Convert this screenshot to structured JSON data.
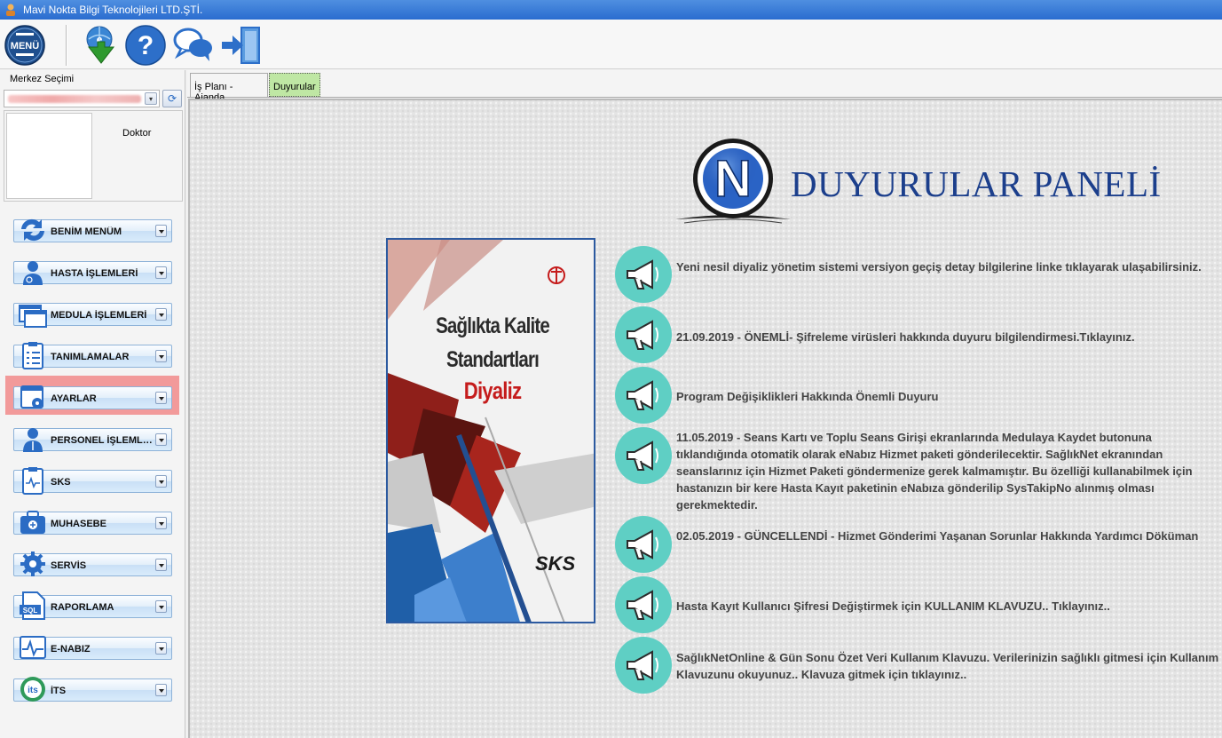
{
  "window": {
    "title": "Mavi Nokta Bilgi Teknolojileri LTD.ŞTİ."
  },
  "toolbar": {
    "menu_label": "MENÜ",
    "buttons": [
      "internet-download-icon",
      "help-icon",
      "chat-icon",
      "logout-icon"
    ]
  },
  "sidebar": {
    "merkez_label": "Merkez Seçimi",
    "role": "Doktor",
    "items": [
      {
        "label": "BENİM MENÜM",
        "icon": "arrows-icon"
      },
      {
        "label": "HASTA İŞLEMLERİ",
        "icon": "patient-icon"
      },
      {
        "label": "MEDULA İŞLEMLERİ",
        "icon": "windows-icon"
      },
      {
        "label": "TANIMLAMALAR",
        "icon": "clipboard-icon"
      },
      {
        "label": "AYARLAR",
        "icon": "settings-calendar-icon"
      },
      {
        "label": "PERSONEL İŞLEMLERİ",
        "icon": "staff-icon"
      },
      {
        "label": "SKS",
        "icon": "sks-clipboard-icon"
      },
      {
        "label": "MUHASEBE",
        "icon": "accounting-icon"
      },
      {
        "label": "SERVİS",
        "icon": "service-gear-icon"
      },
      {
        "label": "RAPORLAMA",
        "icon": "sql-report-icon"
      },
      {
        "label": "E-NABIZ",
        "icon": "pulse-icon"
      },
      {
        "label": "İTS",
        "icon": "its-icon"
      }
    ]
  },
  "tabs": [
    {
      "label": "İş Planı - Ajanda",
      "active": false
    },
    {
      "label": "Duyurular",
      "active": true
    }
  ],
  "content": {
    "panel_title": "DUYURULAR PANELİ",
    "logo_letter": "N",
    "poster": {
      "title_line1": "Sağlıkta Kalite",
      "title_line2": "Standartları",
      "subtitle": "Diyaliz",
      "brand": "SKS"
    },
    "announcements": [
      "Yeni nesil diyaliz yönetim sistemi versiyon geçiş detay bilgilerine linke tıklayarak ulaşabilirsiniz.",
      "21.09.2019 - ÖNEMLİ- Şifreleme virüsleri hakkında duyuru bilgilendirmesi.Tıklayınız.",
      "Program Değişiklikleri Hakkında Önemli Duyuru",
      "11.05.2019 - Seans Kartı ve Toplu Seans Girişi ekranlarında Medulaya Kaydet butonuna tıklandığında otomatik olarak eNabız Hizmet paketi gönderilecektir. SağlıkNet ekranından seanslarınız için Hizmet Paketi göndermenize gerek kalmamıştır. Bu özelliği kullanabilmek için hastanızın bir kere Hasta Kayıt paketinin eNabıza gönderilip SysTakipNo alınmış olması gerekmektedir.",
      "02.05.2019 - GÜNCELLENDİ - Hizmet Gönderimi Yaşanan Sorunlar Hakkında Yardımcı Döküman",
      "Hasta Kayıt Kullanıcı Şifresi Değiştirmek için KULLANIM KLAVUZU.. Tıklayınız..",
      "SağlıkNetOnline & Gün Sonu Özet Veri Kullanım Klavuzu. Verilerinizin sağlıklı gitmesi için Kullanım Klavuzunu okuyunuz.. Klavuza gitmek için tıklayınız.."
    ]
  },
  "colors": {
    "accent": "#1c3f8c",
    "highlight": "#f29a9a",
    "active_tab": "#bfe7a4",
    "megaphone": "#5fcfc4"
  }
}
